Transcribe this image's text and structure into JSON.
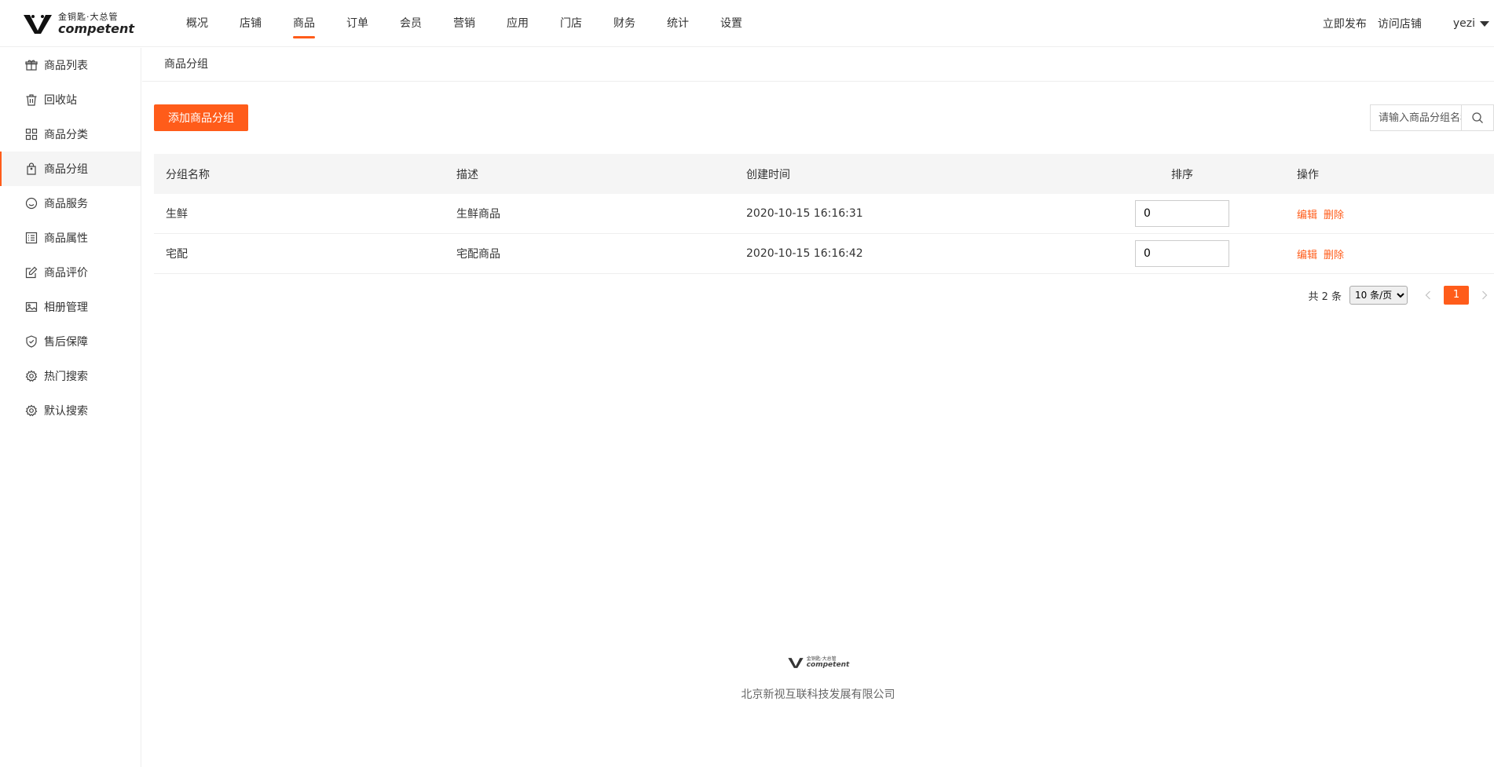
{
  "brand": {
    "cn": "金铜匙·大总管",
    "en": "competent"
  },
  "nav": {
    "items": [
      "概况",
      "店铺",
      "商品",
      "订单",
      "会员",
      "营销",
      "应用",
      "门店",
      "财务",
      "统计",
      "设置"
    ],
    "active_index": 2
  },
  "header_right": {
    "publish": "立即发布",
    "visit": "访问店铺",
    "user": "yezi"
  },
  "sidebar": {
    "items": [
      {
        "label": "商品列表",
        "icon": "gift-icon"
      },
      {
        "label": "回收站",
        "icon": "trash-icon"
      },
      {
        "label": "商品分类",
        "icon": "grid-icon"
      },
      {
        "label": "商品分组",
        "icon": "bag-icon"
      },
      {
        "label": "商品服务",
        "icon": "smile-icon"
      },
      {
        "label": "商品属性",
        "icon": "list-icon"
      },
      {
        "label": "商品评价",
        "icon": "edit-icon"
      },
      {
        "label": "相册管理",
        "icon": "image-icon"
      },
      {
        "label": "售后保障",
        "icon": "shield-icon"
      },
      {
        "label": "热门搜索",
        "icon": "gear-icon"
      },
      {
        "label": "默认搜索",
        "icon": "gear-icon"
      }
    ],
    "active_index": 3
  },
  "breadcrumb": "商品分组",
  "toolbar": {
    "add_label": "添加商品分组",
    "search_placeholder": "请输入商品分组名称"
  },
  "table": {
    "headers": [
      "分组名称",
      "描述",
      "创建时间",
      "排序",
      "操作"
    ],
    "rows": [
      {
        "name": "生鲜",
        "desc": "生鲜商品",
        "created": "2020-10-15 16:16:31",
        "sort": "0",
        "edit": "编辑",
        "delete": "删除"
      },
      {
        "name": "宅配",
        "desc": "宅配商品",
        "created": "2020-10-15 16:16:42",
        "sort": "0",
        "edit": "编辑",
        "delete": "删除"
      }
    ]
  },
  "pagination": {
    "total_text": "共 2 条",
    "page_size": "10 条/页",
    "current_page": "1"
  },
  "footer": {
    "company": "北京新视互联科技发展有限公司"
  },
  "colors": {
    "accent": "#ff5c1a"
  }
}
